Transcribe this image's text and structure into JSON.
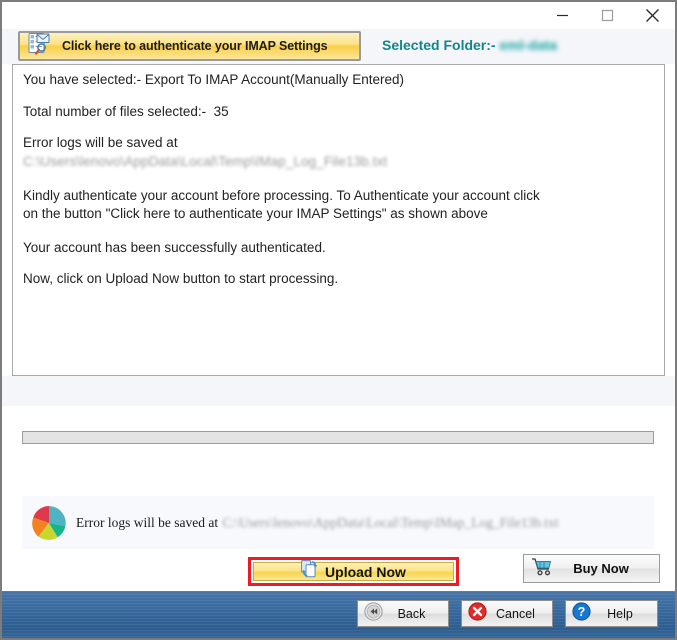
{
  "window": {
    "controls": [
      {
        "name": "minimize",
        "glyph": "minimize-icon",
        "label": "Minimize"
      },
      {
        "name": "maximize",
        "glyph": "maximize-icon",
        "label": "Maximize"
      },
      {
        "name": "close",
        "glyph": "close-icon",
        "label": "Close"
      }
    ]
  },
  "authbar": {
    "auth_button_label": "Click here to authenticate your IMAP Settings",
    "auth_button_icon": "imap-settings-icon",
    "selected_folder_label": "Selected Folder:-",
    "selected_folder_value": "eml-data"
  },
  "main_panel": {
    "line_selection": "You have selected:- Export To IMAP Account(Manually Entered)",
    "line_total_files": "Total number of files selected:-  35",
    "line_error_logs": "Error logs will be saved at",
    "line_log_path": "C:\\Users\\lenovo\\AppData\\Local\\Temp\\IMap_Log_File13b.txt",
    "line_kindly": "Kindly authenticate your account before processing. To Authenticate your account click\non the button \"Click here to authenticate your IMAP Settings\" as shown above",
    "line_authenticated": "Your account has been successfully authenticated.",
    "line_now_click": "Now, click on Upload Now button to start processing."
  },
  "lower_panel": {
    "progress_percent": 0,
    "log_icon": "pie-chart-icon",
    "log_title": "Error logs will be saved at",
    "log_path": "C:\\Users\\lenovo\\AppData\\Local\\Temp\\IMap_Log_File13b.txt",
    "upload_button_label": "Upload Now",
    "upload_button_icon": "upload-copy-icon",
    "buy_button_label": "Buy Now",
    "buy_button_icon": "shopping-cart-icon"
  },
  "footer": {
    "back_label": "Back",
    "back_icon": "rewind-icon",
    "cancel_label": "Cancel",
    "cancel_icon": "error-x-icon",
    "help_label": "Help",
    "help_icon": "question-mark-icon"
  },
  "colors": {
    "accent_yellow": "#f9cf4a",
    "teal": "#11878c",
    "highlight_red": "#ed1c24",
    "footer_blue": "#3d6da3",
    "panel_bg": "#f4f6fa"
  }
}
